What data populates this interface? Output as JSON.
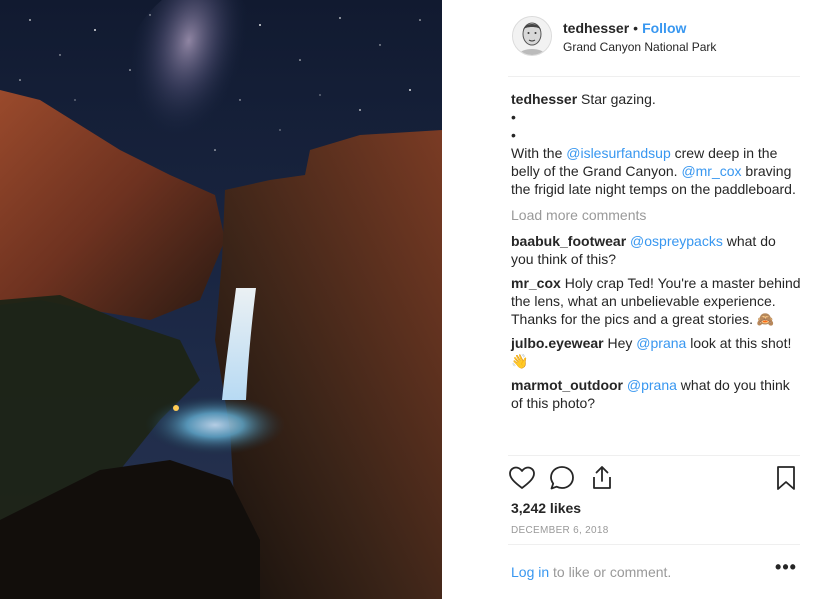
{
  "post": {
    "photo_icon": "night-canyon-waterfall-photo",
    "header": {
      "username": "tedhesser",
      "separator": "•",
      "follow_label": "Follow",
      "location": "Grand Canyon National Park"
    },
    "caption": {
      "username": "tedhesser",
      "line1": "Star gazing.",
      "bullet1": "•",
      "bullet2": "•",
      "text_a": "With the ",
      "mention1": "@islesurfandsup",
      "text_b": " crew deep in the belly of the Grand Canyon. ",
      "mention2": "@mr_cox",
      "text_c": " braving the frigid late night temps on the paddleboard."
    },
    "load_more_label": "Load more comments",
    "comments": [
      {
        "user": "baabuk_footwear",
        "mention": "@ospreypacks",
        "text": " what do you think of this?"
      },
      {
        "user": "mr_cox",
        "text": " Holy crap Ted! You're a master behind the lens, what an unbelievable experience. Thanks for the pics and a great stories. 🙈"
      },
      {
        "user": "julbo.eyewear",
        "pre": " Hey ",
        "mention": "@prana",
        "text": " look at this shot! 👋"
      },
      {
        "user": "marmot_outdoor",
        "mention": "@prana",
        "text": " what do you think of this photo?"
      }
    ],
    "actions": {
      "like_icon": "heart-icon",
      "comment_icon": "comment-icon",
      "share_icon": "share-icon",
      "save_icon": "bookmark-icon"
    },
    "likes": "3,242 likes",
    "date": "December 6, 2018",
    "login": {
      "link": "Log in",
      "text": " to like or comment."
    },
    "more_label": "•••"
  }
}
